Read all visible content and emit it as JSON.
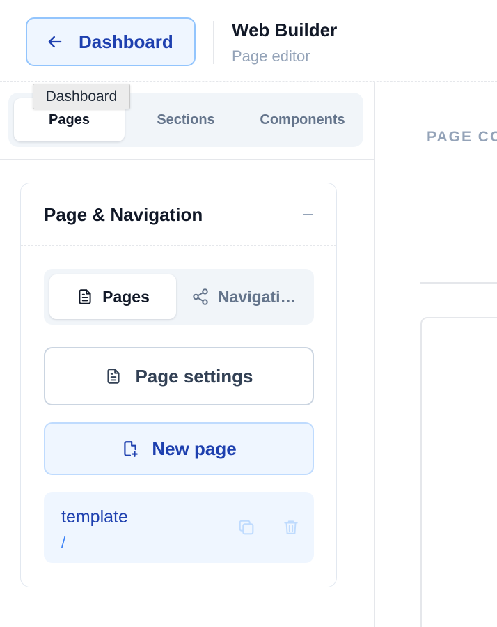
{
  "header": {
    "back_label": "Dashboard",
    "title": "Web Builder",
    "subtitle": "Page editor"
  },
  "tooltip": {
    "text": "Dashboard"
  },
  "sidebar": {
    "tabs": [
      {
        "label": "Pages",
        "active": true
      },
      {
        "label": "Sections",
        "active": false
      },
      {
        "label": "Components",
        "active": false
      }
    ]
  },
  "panel": {
    "title": "Page & Navigation",
    "segments": [
      {
        "label": "Pages",
        "icon": "file-text-icon",
        "active": true
      },
      {
        "label": "Navigati…",
        "icon": "share-nodes-icon",
        "active": false
      }
    ],
    "page_settings_label": "Page settings",
    "new_page_label": "New page",
    "pages": [
      {
        "name": "template",
        "path": "/"
      }
    ]
  },
  "canvas": {
    "label": "PAGE CO"
  },
  "colors": {
    "accent": "#1e40af",
    "accent_bg": "#eff6ff",
    "accent_border": "#93c5fd",
    "muted": "#94a3b8"
  }
}
